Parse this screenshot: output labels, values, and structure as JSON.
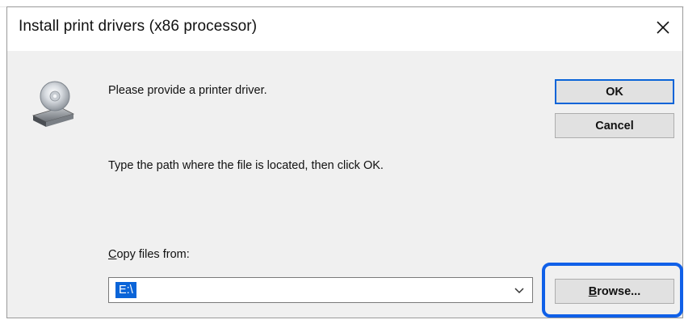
{
  "window": {
    "title": "Install print drivers (x86 processor)"
  },
  "body": {
    "message_primary": "Please provide a printer driver.",
    "message_secondary": "Type the path where the file is located, then click OK.",
    "copy_label_mnemonic": "C",
    "copy_label_rest": "opy files from:",
    "path_value": "E:\\"
  },
  "buttons": {
    "ok_label": "OK",
    "cancel_label": "Cancel",
    "browse_mnemonic": "B",
    "browse_rest": "rowse..."
  },
  "icons": {
    "close": "close-icon",
    "drive": "drive-icon",
    "dropdown": "chevron-down-icon"
  },
  "colors": {
    "accent": "#0a64d8",
    "highlight": "#1060e8",
    "dialog_bg": "#f0f0f0",
    "button_bg": "#e1e1e1"
  }
}
